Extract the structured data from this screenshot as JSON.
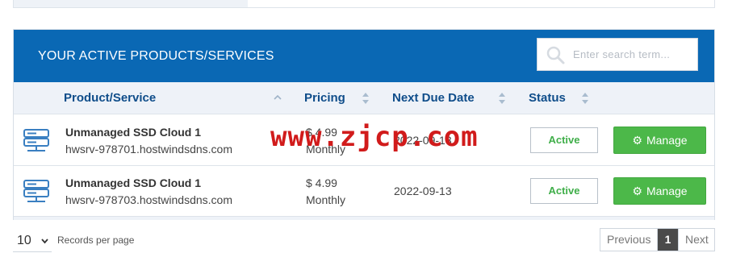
{
  "panel": {
    "title": "YOUR ACTIVE PRODUCTS/SERVICES",
    "search_placeholder": "Enter search term..."
  },
  "table": {
    "columns": [
      {
        "label": "Product/Service",
        "icon": "sort-up-icon"
      },
      {
        "label": "Pricing",
        "icon": "sort-both-icon"
      },
      {
        "label": "Next Due Date",
        "icon": "sort-both-icon"
      },
      {
        "label": "Status",
        "icon": "sort-both-icon"
      }
    ],
    "rows": [
      {
        "icon": "server-icon",
        "product": "Unmanaged SSD Cloud 1",
        "hostname": "hwsrv-978701.hostwindsdns.com",
        "price": "$ 4.99",
        "cycle": "Monthly",
        "due": "2022-09-13",
        "status": "Active",
        "action": "Manage"
      },
      {
        "icon": "server-icon",
        "product": "Unmanaged SSD Cloud 1",
        "hostname": "hwsrv-978703.hostwindsdns.com",
        "price": "$ 4.99",
        "cycle": "Monthly",
        "due": "2022-09-13",
        "status": "Active",
        "action": "Manage"
      }
    ]
  },
  "footer": {
    "records_per_page_value": "10",
    "records_per_page_label": "Records per page",
    "pager": {
      "previous": "Previous",
      "current": "1",
      "next": "Next"
    }
  },
  "watermark": "www.zjcp.com",
  "colors": {
    "header_bg": "#0a68b4",
    "column_header_text": "#0f4d8a",
    "status_active": "#3fae49",
    "manage_button": "#4cb849",
    "watermark": "#d11b1b"
  }
}
